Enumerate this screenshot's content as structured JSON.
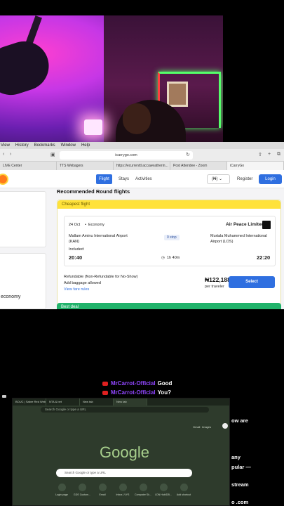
{
  "menu_bar": [
    "View",
    "History",
    "Bookmarks",
    "Window",
    "Help"
  ],
  "browser": {
    "address": "icarrygo.com",
    "tabs": [
      "LIVE Center",
      "TTS Webagers",
      "https://ecurrenttl.accuweatherin...",
      "Post Attendee - Zoom",
      "iCarryGo"
    ]
  },
  "site": {
    "nav": {
      "flight": "Flight",
      "stays": "Stays",
      "activities": "Activities",
      "currency": "(₦)",
      "register": "Register",
      "login": "Login"
    },
    "side_text": "economy",
    "section_title": "Recommended Round flights",
    "cheapest_label": "Cheapest flight",
    "flight": {
      "date": "24 Oct",
      "cabin": "Economy",
      "airline": "Air Peace Limited",
      "from_airport": "Mallam Aminu International Airport (KAN)",
      "to_airport": "Murtala Muhammed International Airport (LOS)",
      "stops": "0 stop",
      "included_label": "Included:",
      "depart_time": "20:40",
      "duration": "1h 40m",
      "arrive_time": "22:20"
    },
    "refund": "Refundable (Non-Refundable for No-Show)",
    "baggage": "Add baggage allowed",
    "fare_rules": "View fare rules",
    "price": "₦122,188",
    "per_traveler": "per traveler",
    "select": "Select",
    "best_deal": "Best deal"
  },
  "chat": [
    {
      "user": "MrCarrot-Official",
      "message": "Good"
    },
    {
      "user": "MrCarrot-Official",
      "message": "You?"
    }
  ],
  "right_fragments": [
    "ow are",
    "any",
    "pular —",
    "stream",
    "o .com"
  ],
  "window2": {
    "tabs": [
      "BOUC | Sabre Red Web",
      "NTA & bet",
      "New tab",
      "New tab"
    ],
    "search_url": "Search Google or type a URL",
    "gmail": "Gmail",
    "images": "Images",
    "logo": "Google",
    "search_placeholder": "Search Google or type a URL",
    "shortcuts": [
      "Login page",
      "GDS Custom...",
      "Email",
      "Inbox | VYS",
      "Computer Sk...",
      "LDN Hub/DB...",
      "Add shortcut"
    ]
  }
}
